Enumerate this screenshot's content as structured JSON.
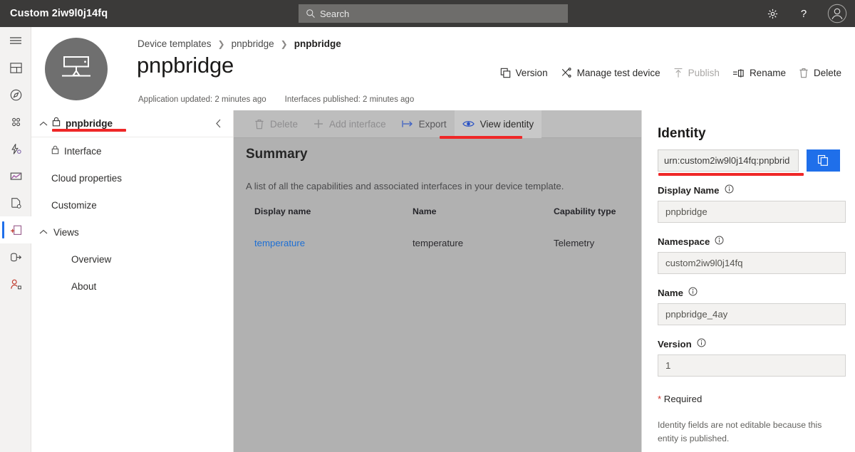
{
  "topbar": {
    "app_title": "Custom 2iw9l0j14fq",
    "search_placeholder": "Search",
    "settings_label": "Settings",
    "help_label": "Help",
    "account_label": "Account"
  },
  "rail": {
    "items": [
      {
        "icon": "hamburger-menu-icon",
        "label": "Menu"
      },
      {
        "icon": "dashboard-icon",
        "label": "Dashboard"
      },
      {
        "icon": "devices-icon",
        "label": "Devices"
      },
      {
        "icon": "device-groups-icon",
        "label": "Device groups"
      },
      {
        "icon": "rules-icon",
        "label": "Rules"
      },
      {
        "icon": "analytics-icon",
        "label": "Analytics"
      },
      {
        "icon": "jobs-icon",
        "label": "Jobs"
      },
      {
        "icon": "device-templates-icon",
        "label": "Device templates",
        "selected": true
      },
      {
        "icon": "data-export-icon",
        "label": "Data export"
      },
      {
        "icon": "administration-icon",
        "label": "Administration"
      }
    ]
  },
  "header": {
    "breadcrumb": [
      "Device templates",
      "pnpbridge",
      "pnpbridge"
    ],
    "title": "pnpbridge",
    "meta": {
      "application_updated": "Application updated: 2 minutes ago",
      "interfaces_published": "Interfaces published: 2 minutes ago"
    },
    "actions": [
      {
        "label": "Version",
        "icon": "version-copy-icon",
        "disabled": false
      },
      {
        "label": "Manage test device",
        "icon": "manage-test-device-icon",
        "disabled": false
      },
      {
        "label": "Publish",
        "icon": "publish-upload-icon",
        "disabled": true
      },
      {
        "label": "Rename",
        "icon": "rename-icon",
        "disabled": false
      },
      {
        "label": "Delete",
        "icon": "trash-icon",
        "disabled": false
      }
    ]
  },
  "tree": {
    "root_label": "pnpbridge",
    "items": [
      {
        "label": "Interface",
        "level": 1,
        "lock": true
      },
      {
        "label": "Cloud properties",
        "level": 1,
        "lock": false
      },
      {
        "label": "Customize",
        "level": 1,
        "lock": false
      },
      {
        "label": "Views",
        "level": 0,
        "group": true
      },
      {
        "label": "Overview",
        "level": 2,
        "lock": false
      },
      {
        "label": "About",
        "level": 2,
        "lock": false
      }
    ]
  },
  "content": {
    "toolbar": [
      {
        "label": "Delete",
        "icon": "trash-icon",
        "state": "disabled"
      },
      {
        "label": "Add interface",
        "icon": "plus-icon",
        "state": "disabled"
      },
      {
        "label": "Export",
        "icon": "export-arrow-icon",
        "state": "enabled"
      },
      {
        "label": "View identity",
        "icon": "eye-icon",
        "state": "active"
      }
    ],
    "summary_title": "Summary",
    "summary_desc": "A list of all the capabilities and associated interfaces in your device template.",
    "table": {
      "columns": [
        "Display name",
        "Name",
        "Capability type"
      ],
      "rows": [
        {
          "display_name": "temperature",
          "name": "temperature",
          "capability_type": "Telemetry"
        }
      ]
    }
  },
  "identity": {
    "title": "Identity",
    "urn_value": "urn:custom2iw9l0j14fq:pnpbrid",
    "copy_button_label": "Copy",
    "fields": [
      {
        "label": "Display Name",
        "value": "pnpbridge"
      },
      {
        "label": "Namespace",
        "value": "custom2iw9l0j14fq"
      },
      {
        "label": "Name",
        "value": "pnpbridge_4ay"
      },
      {
        "label": "Version",
        "value": "1"
      }
    ],
    "required_star": "*",
    "required_text": " Required",
    "note": "Identity fields are not editable because this entity is published."
  },
  "annotations": {
    "color": "#ef2727",
    "underlines": [
      "tree-root-pnpbridge",
      "view-identity-button",
      "identity-urn-field"
    ]
  }
}
